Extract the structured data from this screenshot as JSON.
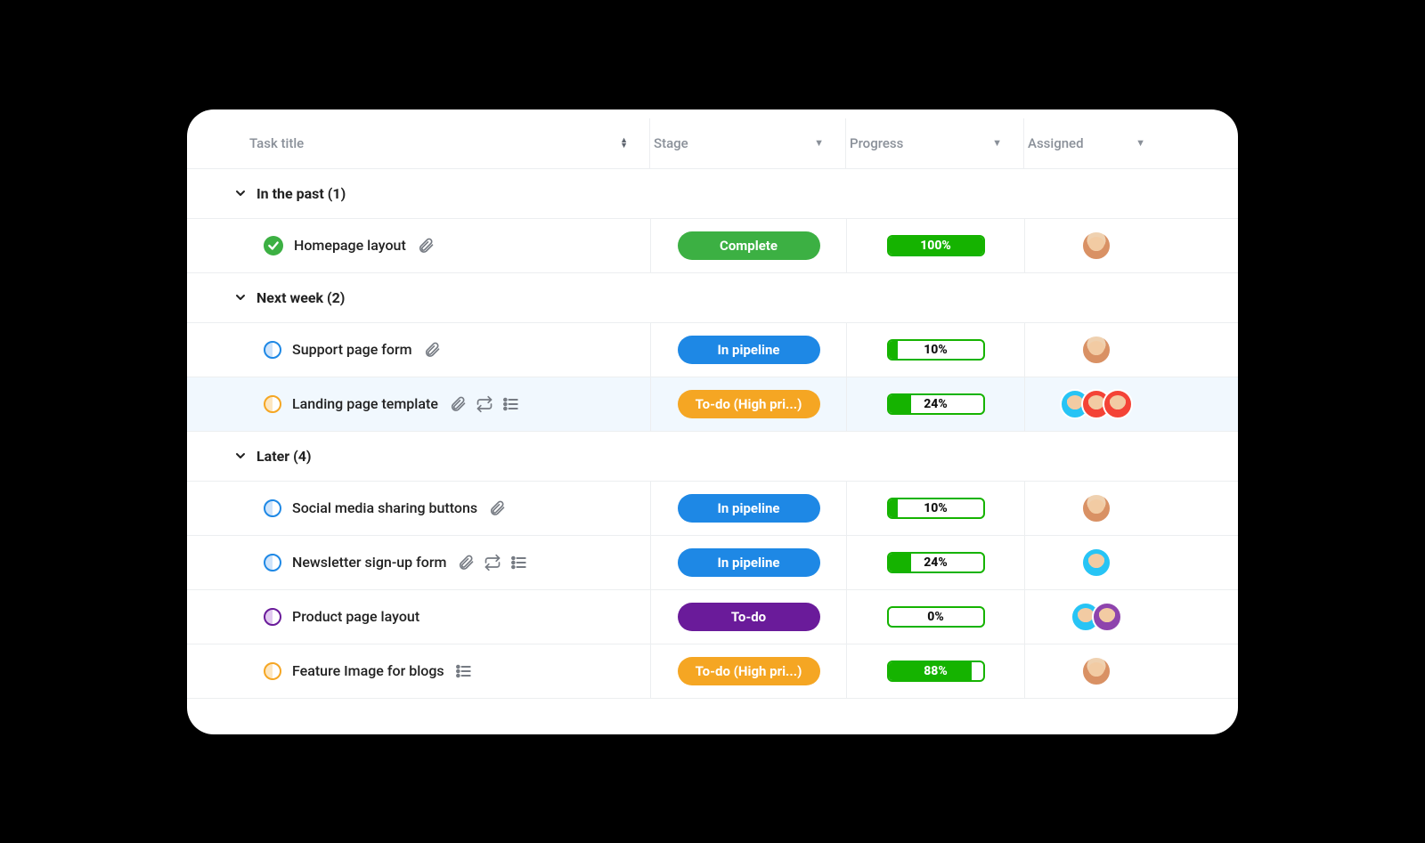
{
  "columns": {
    "title": "Task title",
    "stage": "Stage",
    "progress": "Progress",
    "assigned": "Assigned"
  },
  "stage_labels": {
    "complete": "Complete",
    "pipeline": "In pipeline",
    "todo_high": "To-do (High pri...)",
    "todo": "To-do"
  },
  "groups": [
    {
      "label": "In the past (1)",
      "tasks": [
        {
          "title": "Homepage layout",
          "status_kind": "check",
          "icons": [
            "attachment"
          ],
          "stage": "complete",
          "progress": 100,
          "assignees": [
            {
              "bg": "av1",
              "face": true
            }
          ],
          "highlight": false
        }
      ]
    },
    {
      "label": "Next week (2)",
      "tasks": [
        {
          "title": "Support page form",
          "status_kind": "blue",
          "icons": [
            "attachment"
          ],
          "stage": "pipeline",
          "progress": 10,
          "assignees": [
            {
              "bg": "av1",
              "face": true
            }
          ],
          "highlight": false
        },
        {
          "title": "Landing page template",
          "status_kind": "orange",
          "icons": [
            "attachment",
            "recurring",
            "subtasks"
          ],
          "stage": "todo_high",
          "progress": 24,
          "assignees": [
            {
              "bg": "av-b",
              "face": true
            },
            {
              "bg": "av-r",
              "face": true
            },
            {
              "bg": "av-r",
              "face": true
            }
          ],
          "highlight": true
        }
      ]
    },
    {
      "label": "Later (4)",
      "tasks": [
        {
          "title": "Social media sharing buttons",
          "status_kind": "blue",
          "icons": [
            "attachment"
          ],
          "stage": "pipeline",
          "progress": 10,
          "assignees": [
            {
              "bg": "av1",
              "face": true
            }
          ],
          "highlight": false
        },
        {
          "title": "Newsletter sign-up form",
          "status_kind": "blue",
          "icons": [
            "attachment",
            "recurring",
            "subtasks"
          ],
          "stage": "pipeline",
          "progress": 24,
          "assignees": [
            {
              "bg": "av-b",
              "face": true
            }
          ],
          "highlight": false
        },
        {
          "title": "Product page layout",
          "status_kind": "purple",
          "icons": [],
          "stage": "todo",
          "progress": 0,
          "assignees": [
            {
              "bg": "av-b",
              "face": true
            },
            {
              "bg": "av-p",
              "face": true
            }
          ],
          "highlight": false
        },
        {
          "title": "Feature Image for blogs",
          "status_kind": "orange",
          "icons": [
            "subtasks"
          ],
          "stage": "todo_high",
          "progress": 88,
          "assignees": [
            {
              "bg": "av1",
              "face": true
            }
          ],
          "highlight": false
        }
      ]
    }
  ]
}
